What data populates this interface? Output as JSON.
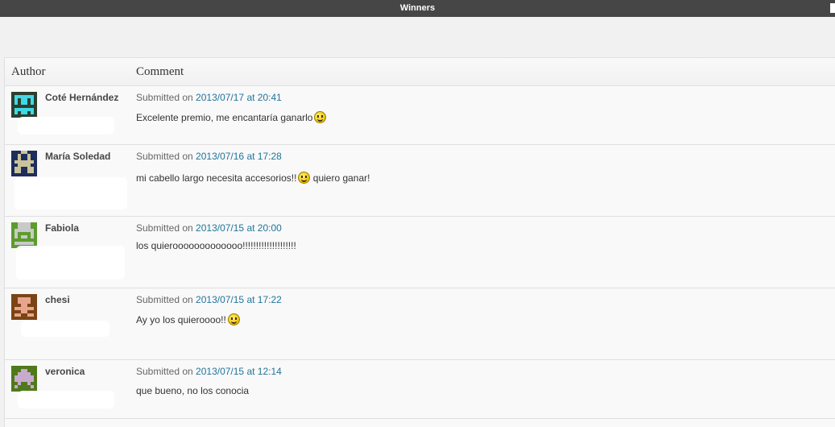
{
  "window": {
    "title": "Winners"
  },
  "table": {
    "headers": {
      "author": "Author",
      "comment": "Comment"
    },
    "submitted_prefix": "Submitted on ",
    "rows": [
      {
        "author": "Coté Hernández",
        "date_link": "2013/07/17 at 20:41",
        "comment": "Excelente premio, me encantaría ganarlo",
        "comment_after": "",
        "smiley": true,
        "avatar_colors": {
          "bg": "#2c3e2e",
          "fg": "#3fd9e6"
        }
      },
      {
        "author": "María Soledad",
        "date_link": "2013/07/16 at 17:28",
        "comment": "mi cabello largo necesita accesorios!!",
        "comment_after": " quiero ganar!",
        "smiley": true,
        "avatar_colors": {
          "bg": "#1d2d5c",
          "fg": "#c9c29a"
        }
      },
      {
        "author": "Fabiola",
        "date_link": "2013/07/15 at 20:00",
        "comment": "los quierooooooooooooo!!!!!!!!!!!!!!!!!!!!",
        "comment_after": "",
        "smiley": false,
        "avatar_colors": {
          "bg": "#5c9c2c",
          "fg": "#c9c9c9"
        }
      },
      {
        "author": "chesi",
        "date_link": "2013/07/15 at 17:22",
        "comment": "Ay yo los quieroooo!!",
        "comment_after": "",
        "smiley": true,
        "avatar_colors": {
          "bg": "#7a4416",
          "fg": "#e8a48c"
        }
      },
      {
        "author": "veronica",
        "date_link": "2013/07/15 at 12:14",
        "comment": "que bueno, no los conocia",
        "comment_after": "",
        "smiley": false,
        "avatar_colors": {
          "bg": "#4f7a1c",
          "fg": "#c8aacd"
        }
      }
    ]
  },
  "icons": {
    "avatar": "pixel-avatar-icon",
    "smiley": "smiley-icon"
  }
}
